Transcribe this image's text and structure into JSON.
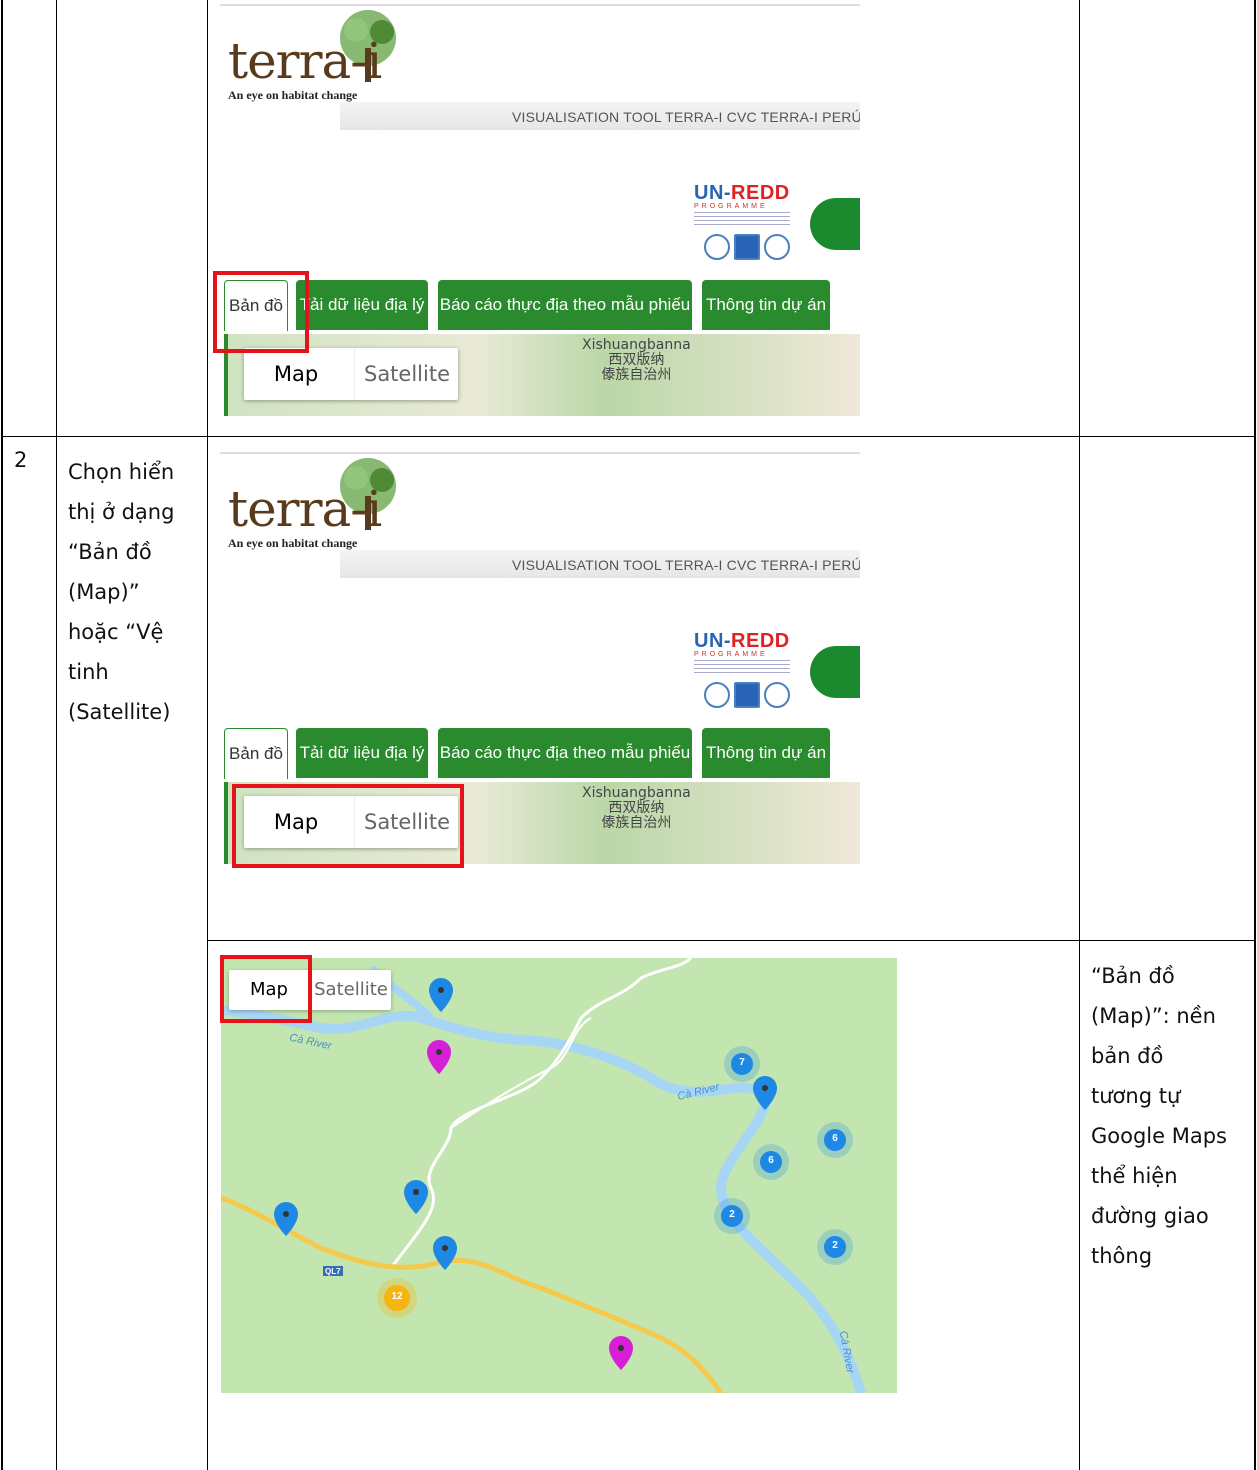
{
  "rows": [
    {
      "number": "",
      "description": [],
      "note": [],
      "screenshot": {
        "logo_word": "terra-i",
        "logo_tagline": "An eye on habitat change",
        "nav_text": "VISUALISATION TOOL  TERRA-I CVC  TERRA-I PERÚ  T",
        "partner_name_a": "UN-",
        "partner_name_b": "REDD",
        "partner_sub": "PROGRAMME",
        "tabs": [
          "Bản đồ",
          "Tải dữ liệu địa lý",
          "Báo cáo thực địa theo mẫu phiếu",
          "Thông tin dự án"
        ],
        "map_button": "Map",
        "satellite_button": "Satellite",
        "place_label_1": "Xishuangbanna",
        "place_label_2": "西双版纳",
        "place_label_3": "傣族自治州"
      }
    },
    {
      "number": "2",
      "description": [
        "Chọn hiển",
        "thị ở dạng",
        "“Bản đồ",
        "(Map)”",
        "hoặc “Vệ",
        "tinh",
        "(Satellite)"
      ],
      "note": [],
      "screenshot": {
        "logo_word": "terra-i",
        "logo_tagline": "An eye on habitat change",
        "nav_text": "VISUALISATION TOOL  TERRA-I CVC  TERRA-I PERÚ  T",
        "partner_name_a": "UN-",
        "partner_name_b": "REDD",
        "partner_sub": "PROGRAMME",
        "tabs": [
          "Bản đồ",
          "Tải dữ liệu địa lý",
          "Báo cáo thực địa theo mẫu phiếu",
          "Thông tin dự án"
        ],
        "map_button": "Map",
        "satellite_button": "Satellite",
        "place_label_1": "Xishuangbanna",
        "place_label_2": "西双版纳",
        "place_label_3": "傣族自治州"
      }
    },
    {
      "number": "",
      "description": [],
      "note": [
        "“Bản đồ",
        "(Map)”: nền",
        "bản đồ",
        "tương tự",
        "Google Maps",
        "thể hiện",
        "đường giao",
        "thông"
      ],
      "map": {
        "map_button": "Map",
        "satellite_button": "Satellite",
        "river_label_1": "Cà River",
        "river_label_2": "Cà River",
        "river_label_3": "Cà River",
        "road_label": "QL7",
        "clusters": [
          "7",
          "6",
          "6",
          "2",
          "2",
          "12"
        ]
      }
    }
  ],
  "colors": {
    "tab_green": "#2a8a2e",
    "highlight_red": "#e3141b",
    "pin_blue": "#1e88e5",
    "pin_magenta": "#d61fd6",
    "cluster_yellow": "#f6b40e",
    "map_land": "#c3e6b0",
    "river": "#aadaff"
  }
}
